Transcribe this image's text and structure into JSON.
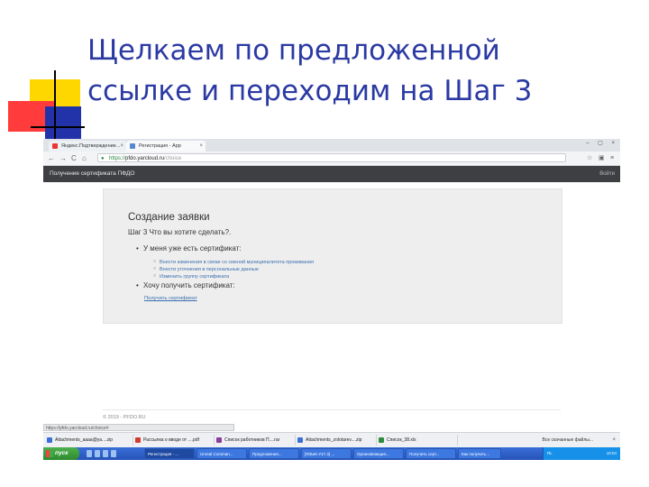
{
  "slide": {
    "title_line1": "Щелкаем по предложенной",
    "title_line2": "ссылке и переходим на Шаг 3"
  },
  "browser": {
    "tabs": [
      {
        "label": "Яндекс.Подтверждение...",
        "close": "×"
      },
      {
        "label": "Регистрация - App",
        "close": "×"
      }
    ],
    "window_controls": "– ▢ ×",
    "nav": {
      "back": "←",
      "forward": "→",
      "reload": "C",
      "home": "⌂"
    },
    "address": {
      "scheme": "https://",
      "host": "pfdo.yarcloud.ru",
      "path": "/choice",
      "lock": "🔒"
    },
    "toolbar_icons": {
      "star": "☆",
      "menu": "≡"
    }
  },
  "site": {
    "header_title": "Получение сертификата ПФДО",
    "login_label": "Войти"
  },
  "form": {
    "heading": "Создание заявки",
    "step": "Шаг 3 Что вы хотите сделать?.",
    "option1": {
      "label": "У меня уже есть сертификат:",
      "bullet": "•",
      "sublinks": [
        "Внести изменения в связи со сменой муниципалитета проживания",
        "Внести уточнения в персональные данные",
        "Изменить группу сертификата"
      ]
    },
    "option2": {
      "label": "Хочу получить сертификат:",
      "bullet": "•",
      "link": "Получить сертификат"
    }
  },
  "footer": {
    "copyright": "© 2019 - PFDO.RU"
  },
  "status_url": "https://pfdo.yarcloud.ru/choice#",
  "downloads": {
    "items": [
      {
        "name": "Attachments_aaaa@ya....zip",
        "icon_color": "#3b6fd4"
      },
      {
        "name": "Рассылка о вводе от ....pdf",
        "icon_color": "#d23b2f"
      },
      {
        "name": "Список работников П....rar",
        "icon_color": "#8a3b9e"
      },
      {
        "name": "Attachments_zolotarev....zip",
        "icon_color": "#3b6fd4"
      },
      {
        "name": "Список_38.xls",
        "icon_color": "#2e8b3e"
      }
    ],
    "show_all": "Все скачанные файлы...",
    "close": "×"
  },
  "taskbar": {
    "start_label": "пуск",
    "items": [
      "Регистрация - ...",
      "Unreal Comman...",
      "Предложения...",
      "[ЯЗЫК-У17.4] ...",
      "Органовеакция...",
      "Получить серт...",
      "Как получить..."
    ],
    "lang": "RL",
    "clock": "10:04"
  }
}
